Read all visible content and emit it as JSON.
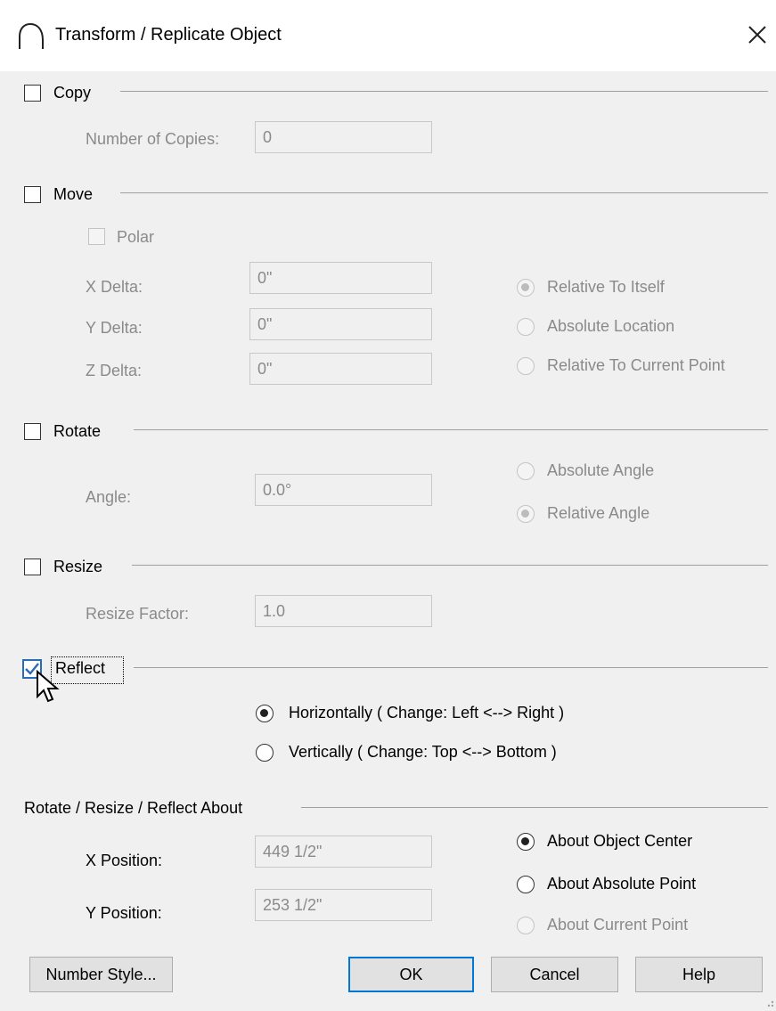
{
  "window": {
    "title": "Transform / Replicate Object"
  },
  "copy": {
    "label": "Copy",
    "checked": false,
    "number_label": "Number of Copies:",
    "number_value": "0"
  },
  "move": {
    "label": "Move",
    "checked": false,
    "polar_label": "Polar",
    "x_label": "X Delta:",
    "x_value": "0\"",
    "y_label": "Y Delta:",
    "y_value": "0\"",
    "z_label": "Z Delta:",
    "z_value": "0\"",
    "options": [
      "Relative To Itself",
      "Absolute Location",
      "Relative To Current Point"
    ],
    "selected": "Relative To Itself"
  },
  "rotate": {
    "label": "Rotate",
    "checked": false,
    "angle_label": "Angle:",
    "angle_value": "0.0°",
    "options": [
      "Absolute Angle",
      "Relative Angle"
    ],
    "selected": "Relative Angle"
  },
  "resize": {
    "label": "Resize",
    "checked": false,
    "factor_label": "Resize Factor:",
    "factor_value": "1.0"
  },
  "reflect": {
    "label": "Reflect",
    "checked": true,
    "options": [
      "Horizontally ( Change: Left <--> Right )",
      "Vertically ( Change: Top <--> Bottom )"
    ],
    "selected": "Horizontally ( Change: Left <--> Right )"
  },
  "about": {
    "label": "Rotate / Resize / Reflect About",
    "x_label": "X Position:",
    "x_value": "449 1/2\"",
    "y_label": "Y Position:",
    "y_value": "253 1/2\"",
    "options": [
      "About Object Center",
      "About Absolute Point",
      "About Current Point"
    ],
    "selected": "About Object Center"
  },
  "buttons": {
    "number_style": "Number Style...",
    "ok": "OK",
    "cancel": "Cancel",
    "help": "Help"
  },
  "colors": {
    "accent": "#0078d7",
    "check": "#2b6cb8"
  }
}
